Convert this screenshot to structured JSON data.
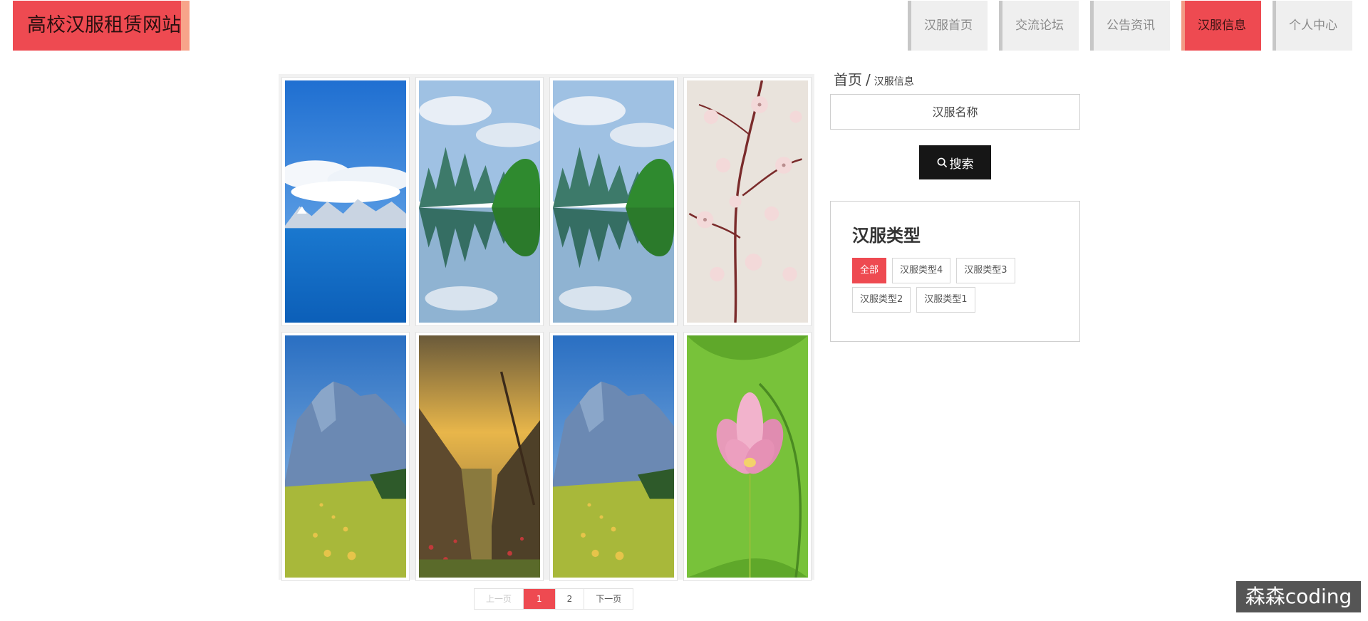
{
  "header": {
    "brand": "高校汉服租赁网站",
    "nav": [
      {
        "label": "汉服首页",
        "active": false
      },
      {
        "label": "交流论坛",
        "active": false
      },
      {
        "label": "公告资讯",
        "active": false
      },
      {
        "label": "汉服信息",
        "active": true
      },
      {
        "label": "个人中心",
        "active": false
      }
    ]
  },
  "gallery": {
    "items": [
      {
        "scene": "blue-lake-snow-mountain"
      },
      {
        "scene": "karst-peaks-reflection"
      },
      {
        "scene": "karst-peaks-reflection"
      },
      {
        "scene": "cherry-blossom-branch"
      },
      {
        "scene": "mountain-meadow-haybales"
      },
      {
        "scene": "sunset-valley"
      },
      {
        "scene": "mountain-meadow-haybales"
      },
      {
        "scene": "pink-lotus"
      }
    ]
  },
  "pagination": {
    "prev": "上一页",
    "pages": [
      "1",
      "2"
    ],
    "current": "1",
    "next": "下一页"
  },
  "sidebar": {
    "breadcrumb": {
      "home": "首页",
      "separator": "/",
      "current": "汉服信息"
    },
    "search": {
      "placeholder": "汉服名称",
      "value": "",
      "button_label": "搜索",
      "button_icon": "search-icon"
    },
    "types": {
      "title": "汉服类型",
      "tags": [
        {
          "label": "全部",
          "active": true
        },
        {
          "label": "汉服类型4",
          "active": false
        },
        {
          "label": "汉服类型3",
          "active": false
        },
        {
          "label": "汉服类型2",
          "active": false
        },
        {
          "label": "汉服类型1",
          "active": false
        }
      ]
    }
  },
  "watermark": "森森coding",
  "colors": {
    "accent": "#ee4a51",
    "accent_edge": "#f7a48a",
    "button_dark": "#161616"
  }
}
